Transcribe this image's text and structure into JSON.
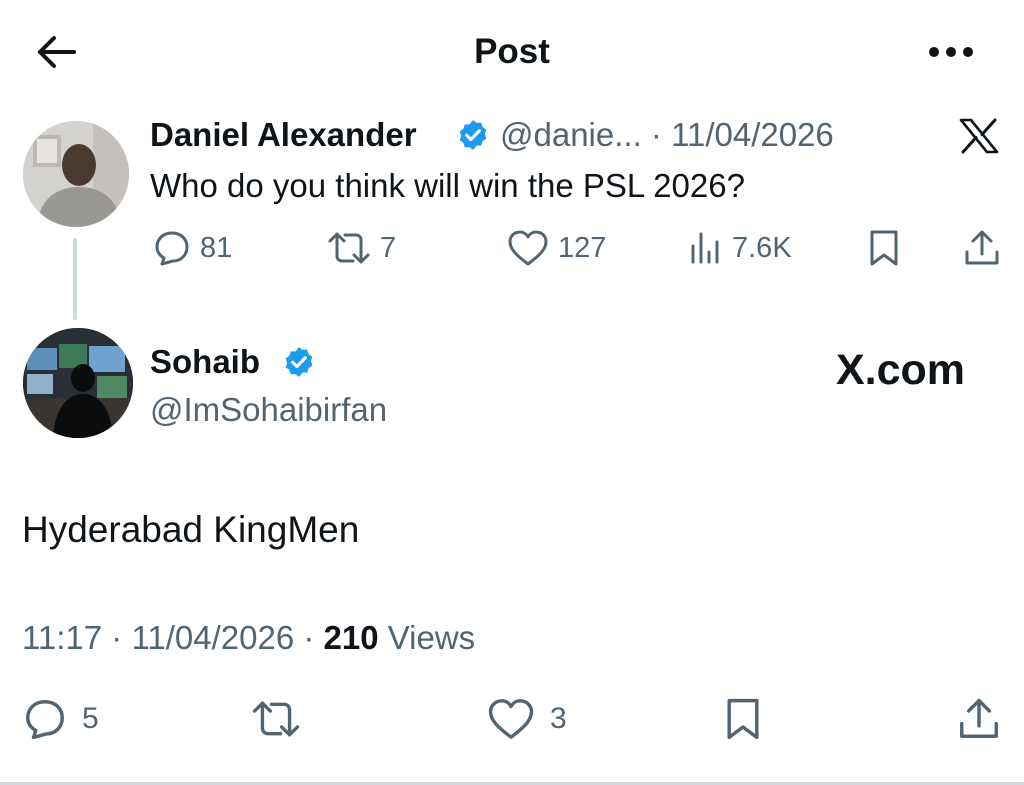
{
  "header": {
    "title": "Post"
  },
  "parent_post": {
    "display_name": "Daniel Alexander",
    "handle_date": "@danie... · 11/04/2026",
    "text": "Who do you think will win the PSL 2026?",
    "stats": {
      "replies": "81",
      "reposts": "7",
      "likes": "127",
      "views": "7.6K"
    }
  },
  "reply_post": {
    "display_name": "Sohaib",
    "handle": "@ImSohaibirfan",
    "watermark": "X.com",
    "text": "Hyderabad KingMen",
    "timestamp": "11:17 · 11/04/2026 · ",
    "views_count": "210",
    "views_label": " Views",
    "stats": {
      "replies": "5",
      "likes": "3"
    }
  },
  "icons": {
    "back": "back-arrow-icon",
    "more": "more-dots-icon",
    "verified": "verified-badge-icon",
    "x_logo": "x-logo-icon",
    "reply": "reply-icon",
    "repost": "repost-icon",
    "like": "heart-icon",
    "views": "views-icon",
    "bookmark": "bookmark-icon",
    "share": "share-icon"
  },
  "colors": {
    "text": "#0f1419",
    "secondary": "#536471",
    "verified": "#1d9bf0",
    "divider": "#cfd9de"
  }
}
